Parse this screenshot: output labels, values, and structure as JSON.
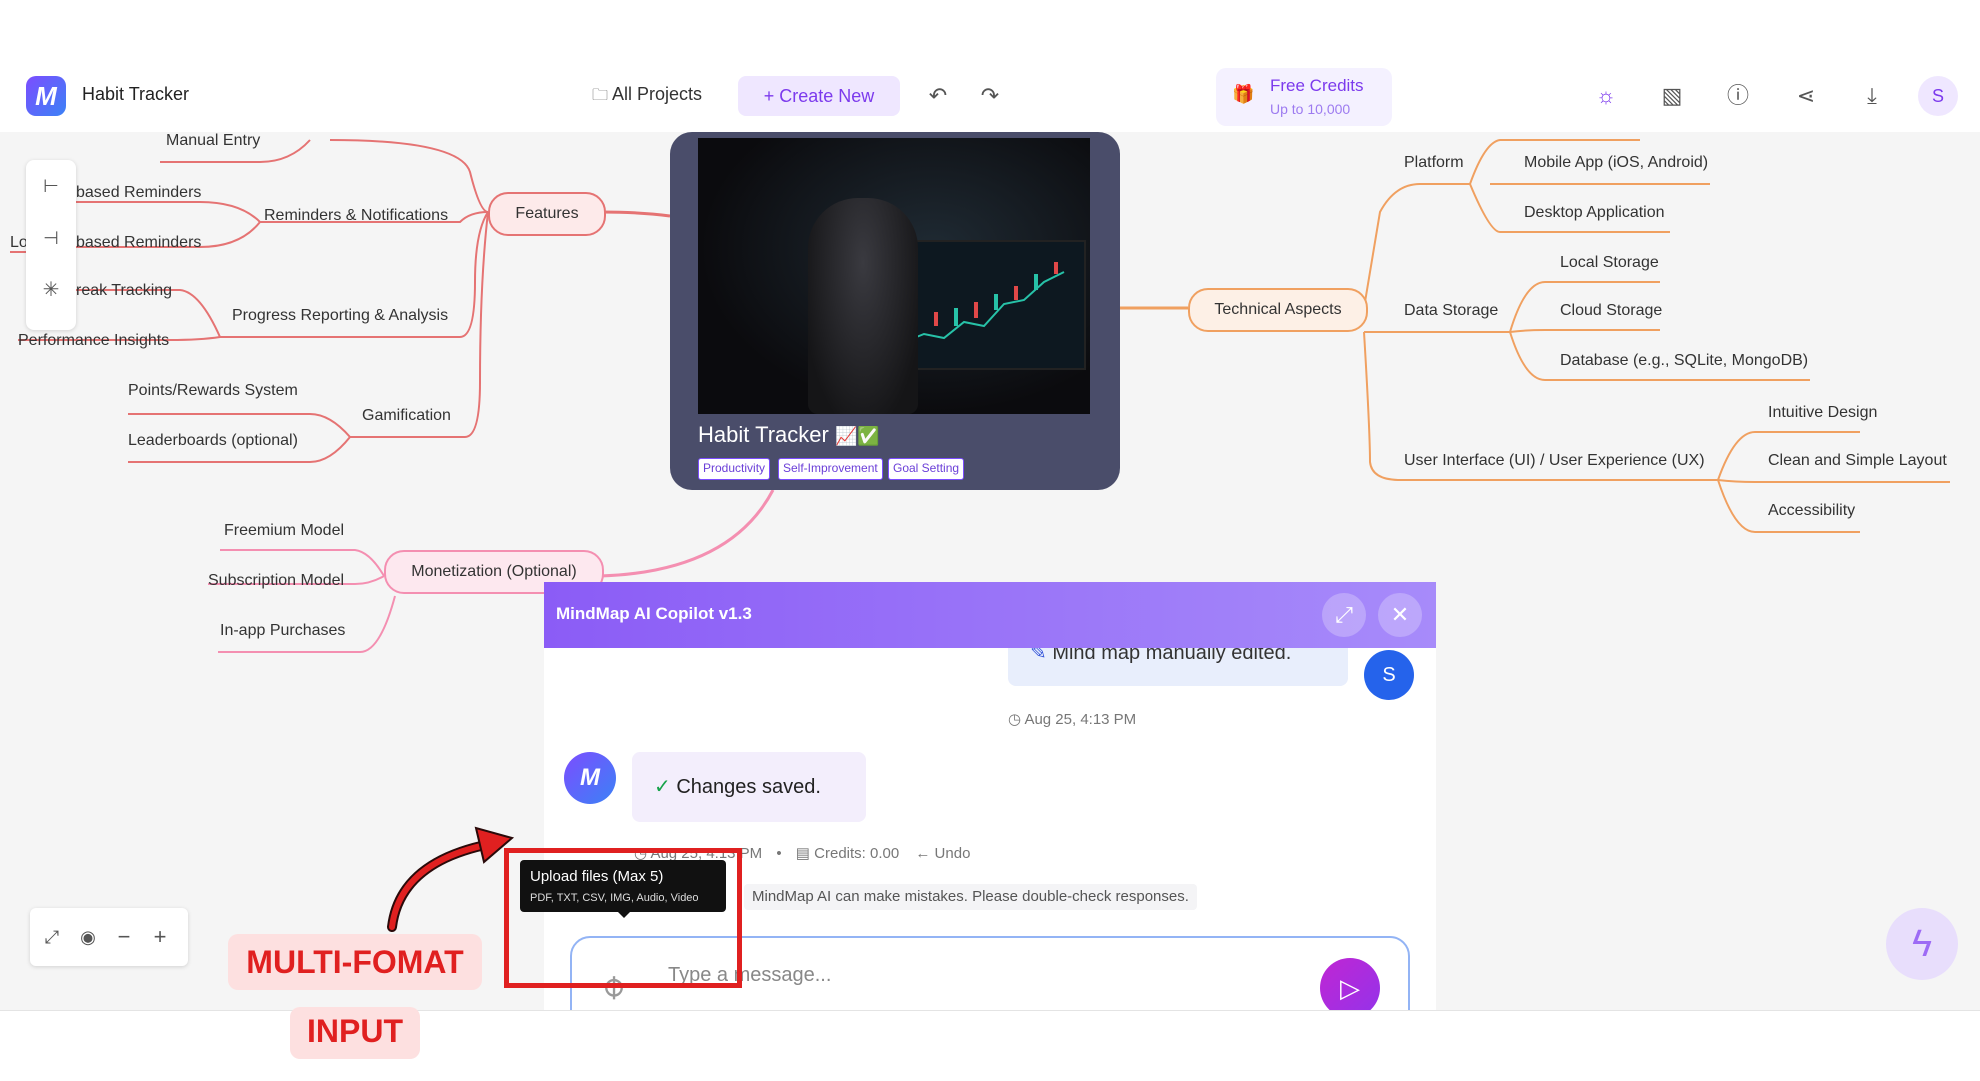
{
  "header": {
    "app_title": "Habit Tracker",
    "all_projects": "All Projects",
    "create_new": "Create New",
    "credits_title": "Free Credits",
    "credits_sub": "Up to 10,000",
    "avatar_letter": "S"
  },
  "mindmap": {
    "root_title": "Habit Tracker",
    "root_emoji": "📈✅",
    "tags": [
      "Productivity",
      "Self-Improvement",
      "Goal Setting"
    ],
    "features": {
      "label": "Features",
      "manual_entry": "Manual Entry",
      "reminders": "Reminders & Notifications",
      "time_based": "based Reminders",
      "loc_based": "based Reminders",
      "loc_prefix": "Lo",
      "progress": "Progress Reporting & Analysis",
      "streak": "reak Tracking",
      "performance": "Performance Insights",
      "gamification": "Gamification",
      "points": "Points/Rewards System",
      "leaderboards": "Leaderboards (optional)"
    },
    "monetization": {
      "label": "Monetization (Optional)",
      "freemium": "Freemium Model",
      "subscription": "Subscription Model",
      "inapp": "In-app Purchases"
    },
    "technical": {
      "label": "Technical Aspects",
      "platform": "Platform",
      "mobile": "Mobile App (iOS, Android)",
      "desktop": "Desktop Application",
      "data_storage": "Data Storage",
      "local": "Local Storage",
      "cloud": "Cloud Storage",
      "database": "Database (e.g., SQLite, MongoDB)",
      "ui": "User Interface (UI) / User Experience (UX)",
      "intuitive": "Intuitive Design",
      "clean": "Clean and Simple Layout",
      "accessibility": "Accessibility"
    }
  },
  "chat": {
    "title": "MindMap AI Copilot v1.3",
    "user_message": "Mind map manually edited.",
    "user_avatar": "S",
    "user_time": "Aug 25, 4:13 PM",
    "ai_message": "Changes saved.",
    "ai_time": "Aug 25, 4:13 PM",
    "credits": "Credits: 0.00",
    "undo": "Undo",
    "disclaimer": "MindMap AI can make mistakes. Please double-check responses.",
    "tooltip_title": "Upload files (Max 5)",
    "tooltip_sub": "PDF, TXT, CSV, IMG, Audio, Video",
    "input_placeholder": "Type a message..."
  },
  "annotation": {
    "line1": "MULTI-FOMAT",
    "line2": "INPUT"
  },
  "colors": {
    "accent": "#7c3aed",
    "features_branch": "#e57373",
    "technical_branch": "#f0a060",
    "monetization_branch": "#f48fb1",
    "annotation_red": "#e02020"
  },
  "icons": {
    "redo": "redo-icon",
    "undo": "undo-icon",
    "theme": "sun-icon",
    "layout": "layout-icon",
    "help": "help-icon",
    "share": "share-icon",
    "download": "download-icon",
    "attach": "paperclip-icon",
    "send": "send-icon",
    "bolt": "lightning-icon"
  }
}
